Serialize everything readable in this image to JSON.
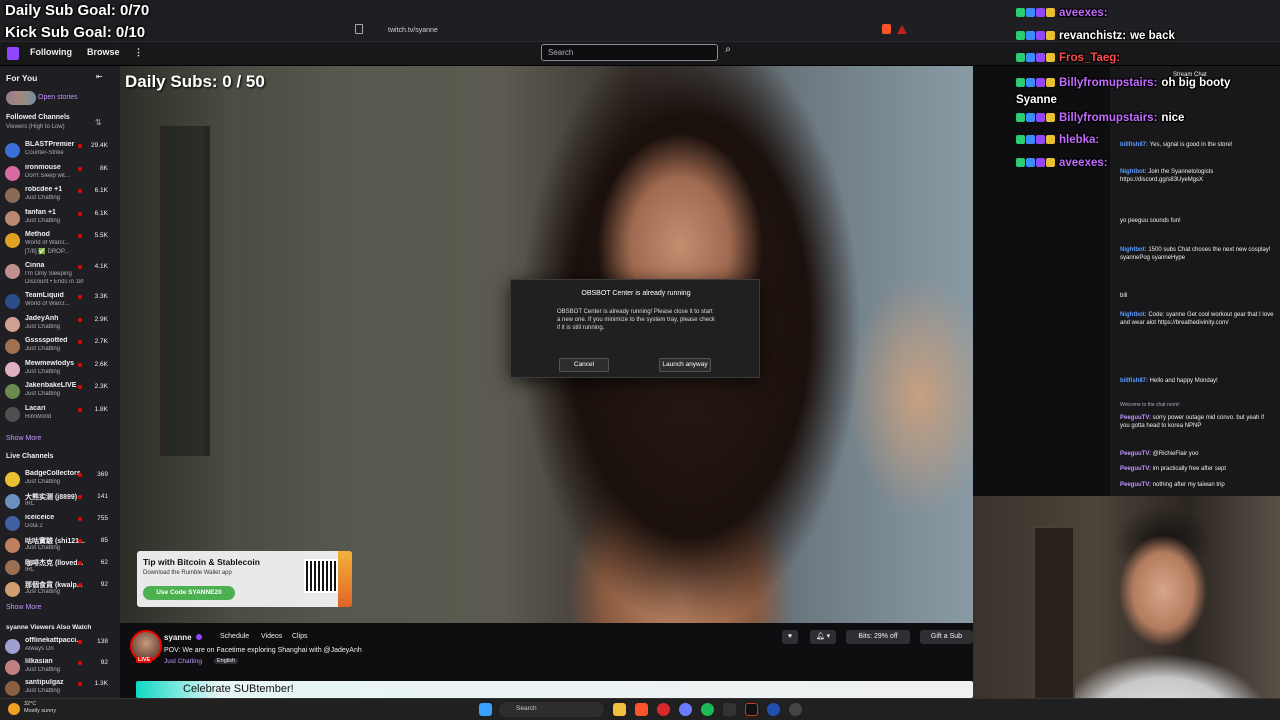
{
  "overlay": {
    "daily_sub_goal": "Daily Sub Goal: 0/70",
    "kick_sub_goal": "Kick Sub Goal: 0/10",
    "daily_subs": "Daily Subs: 0 / 50"
  },
  "browser": {
    "url": "twitch.tv/syanne"
  },
  "nav": {
    "following": "Following",
    "browse": "Browse",
    "more": "⋮",
    "search_placeholder": "Search"
  },
  "sidebar": {
    "for_you": "For You",
    "open_stories": "Open stories",
    "followed_channels": "Followed Channels",
    "sort": "Viewers (High to Low)",
    "followed": [
      {
        "name": "BLASTPremier",
        "cat": "Counter-Strike",
        "count": "29.4K",
        "color": "#3a6fd8"
      },
      {
        "name": "ironmouse",
        "cat": "Don't Sleep wit...",
        "count": "8K",
        "color": "#d86aa0"
      },
      {
        "name": "robcdee +1",
        "cat": "Just Chatting",
        "count": "6.1K",
        "color": "#8c6b55"
      },
      {
        "name": "fanfan +1",
        "cat": "Just Chatting",
        "count": "6.1K",
        "color": "#b98a70"
      },
      {
        "name": "Method",
        "cat": "World of Warcr...",
        "count": "5.5K",
        "color": "#e0a020",
        "extra": "[7/8] ✅ DROP..."
      },
      {
        "name": "Cinna",
        "cat": "I'm Only Sleeping",
        "count": "4.1K",
        "color": "#c09090",
        "extra": "Discount • Ends in 18!"
      },
      {
        "name": "TeamLiquid",
        "cat": "World of Warcr...",
        "count": "3.3K",
        "color": "#2a4d8a"
      },
      {
        "name": "JadeyAnh",
        "cat": "Just Chatting",
        "count": "2.9K",
        "color": "#d0a090"
      },
      {
        "name": "Gsssspotted",
        "cat": "Just Chatting",
        "count": "2.7K",
        "color": "#a07050"
      },
      {
        "name": "Mewmewlodys",
        "cat": "Just Chatting",
        "count": "2.6K",
        "color": "#e0b0c0"
      },
      {
        "name": "JakenbakeLIVE",
        "cat": "Just Chatting",
        "count": "2.3K",
        "color": "#6a8a50"
      },
      {
        "name": "Lacari",
        "cat": "RimWorld",
        "count": "1.8K",
        "color": "#505050"
      }
    ],
    "show_more_1": "Show More",
    "live_channels": "Live Channels",
    "live": [
      {
        "name": "BadgeCollectors",
        "cat": "Just Chatting",
        "count": "369",
        "color": "#e8c030"
      },
      {
        "name": "大熊实测 (j8899)",
        "cat": "IRL",
        "count": "141",
        "color": "#6a90c0"
      },
      {
        "name": "iceiceice",
        "cat": "Dota 2",
        "count": "755",
        "color": "#4060a0"
      },
      {
        "name": "咕咕實驗 (shi121...",
        "cat": "Just Chatting",
        "count": "85",
        "color": "#c08060"
      },
      {
        "name": "咖啡杰克 (lloved...",
        "cat": "IRL",
        "count": "62",
        "color": "#9a7050"
      },
      {
        "name": "那個食貨 (kwalp...",
        "cat": "Just Chatting",
        "count": "92",
        "color": "#d0a070"
      }
    ],
    "show_more_2": "Show More",
    "also_watch": "syanne Viewers Also Watch",
    "also": [
      {
        "name": "offlinekattpacci...",
        "cat": "Always On",
        "count": "138",
        "color": "#a0a0d0"
      },
      {
        "name": "lilkasian",
        "cat": "Just Chatting",
        "count": "92",
        "color": "#c08080"
      },
      {
        "name": "santipulgaz",
        "cat": "Just Chatting",
        "count": "1.3K",
        "color": "#8a6040"
      }
    ]
  },
  "dialog": {
    "title": "OBSBOT Center is already running",
    "message": "OBSBOT Center is already running! Please close it to start a new one. If you minimize to the system tray, please check if it is still running.",
    "cancel": "Cancel",
    "launch": "Launch anyway"
  },
  "ad": {
    "headline": "Tip with Bitcoin & Stablecoin",
    "sub": "Download the Rumble Wallet app",
    "code": "Use Code SYANNE20"
  },
  "channel": {
    "name": "syanne",
    "schedule": "Schedule",
    "videos": "Videos",
    "clips": "Clips",
    "live": "LIVE",
    "title": "POV: We are on Facetime exploring Shanghai with @JadeyAnh",
    "category": "Just Chatting",
    "language": "English",
    "bits": "Bits: 29% off",
    "gift": "Gift a Sub"
  },
  "banner": {
    "celebrate": "Celebrate SUBtember!"
  },
  "chat": {
    "title": "Stream Chat",
    "messages": [
      {
        "user": "billfish87:",
        "text": "Yes, signal is good in the store!",
        "color": "#5b9bff"
      },
      {
        "user": "Nightbot:",
        "text": "Join the Syannetologists https://discord.gg/s83UyeMgsX",
        "color": "#5b9bff"
      },
      {
        "user": "",
        "text": "yo peeguu sounds fun!",
        "color": "#eb4040"
      },
      {
        "user": "Nightbot:",
        "text": "1500 subs Chat choses the next new cosplay! syannePog syanneHype",
        "color": "#5b9bff"
      },
      {
        "user": "",
        "text": "bill",
        "color": "#eb4040"
      },
      {
        "user": "Nightbot:",
        "text": "Code: syanne Get cool workout gear that I love and wear alot https://breathedivinity.com/",
        "color": "#5b9bff"
      },
      {
        "user": "billfish87:",
        "text": "Hello and happy Monday!",
        "color": "#5b9bff"
      },
      {
        "user": "PeeguuTV:",
        "text": "sorry power outage mid convo. but yeah if you gotta head to korea NPNP",
        "color": "#bf94ff"
      },
      {
        "user": "PeeguuTV:",
        "text": "@RichieFlair yoo",
        "color": "#bf94ff"
      },
      {
        "user": "PeeguuTV:",
        "text": "im practically free after sept",
        "color": "#bf94ff"
      },
      {
        "user": "PeeguuTV:",
        "text": "nothing after my taiwan trip",
        "color": "#bf94ff"
      }
    ],
    "welcome": "Welcome to the chat room!"
  },
  "overlay_chat": [
    {
      "user": "aveexes:",
      "text": "",
      "color": "#c46bff"
    },
    {
      "user": "revanchistz:",
      "text": "we back",
      "color": "#ffffff"
    },
    {
      "user": "Fros_Taeg:",
      "text": "",
      "color": "#ff4b4b"
    },
    {
      "user": "Billyfromupstairs:",
      "text": "oh big booty Syanne",
      "color": "#c46bff"
    },
    {
      "user": "Billyfromupstairs:",
      "text": "nice",
      "color": "#c46bff"
    },
    {
      "user": "hlebka:",
      "text": "",
      "color": "#c46bff"
    },
    {
      "user": "aveexes:",
      "text": "",
      "color": "#c46bff"
    }
  ],
  "taskbar": {
    "temp": "32°C",
    "weather": "Mostly sunny",
    "search": "Search"
  },
  "colors": {
    "twitch_purple": "#9146ff",
    "live_red": "#eb0400",
    "link_purple": "#bf94ff"
  }
}
